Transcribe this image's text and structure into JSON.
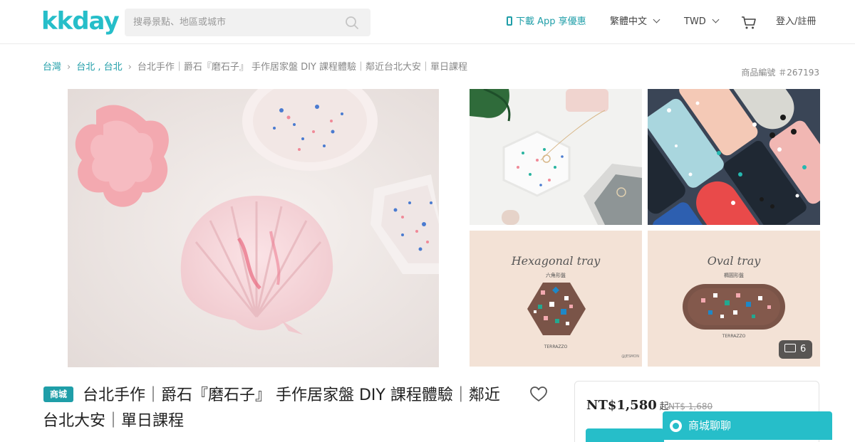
{
  "header": {
    "logo": "kkday",
    "search_placeholder": "搜尋景點、地區或城市",
    "app_link": "下載 App 享優惠",
    "language": "繁體中文",
    "currency": "TWD",
    "login": "登入/註冊"
  },
  "breadcrumb": {
    "items": [
      "台灣",
      "台北 , 台北"
    ],
    "current": "台北手作｜爵石『磨石子』 手作居家盤 DIY 課程體驗｜鄰近台北大安｜單日課程"
  },
  "product_no": "商品編號 ＃267193",
  "gallery": {
    "thumb3_title": "Hexagonal tray",
    "thumb3_subtitle": "六角形盤",
    "thumb3_brand": "TERRAZZO",
    "thumb3_credit": "@JESMON",
    "thumb4_title": "Oval tray",
    "thumb4_subtitle": "橢圓形盤",
    "thumb4_brand": "TERRAZZO",
    "photo_count": "6"
  },
  "product": {
    "badge": "商城",
    "title": "台北手作｜爵石『磨石子』 手作居家盤 DIY 課程體驗｜鄰近台北大安｜單日課程"
  },
  "pricing": {
    "price": "NT$1,580",
    "suffix": "起",
    "original_price": "NT$ 1,680"
  },
  "chat": {
    "label": "商城聊聊"
  },
  "colors": {
    "brand": "#26bec9",
    "link": "#1f9ea8"
  }
}
